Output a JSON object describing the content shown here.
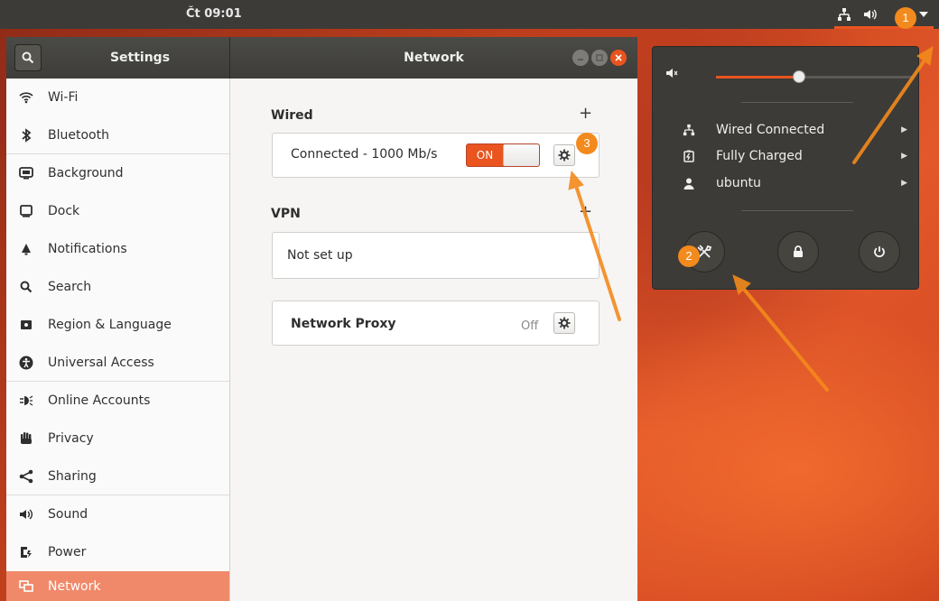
{
  "topbar": {
    "clock": "Čt 09:01",
    "tray_icons": [
      "network-icon",
      "volume-icon",
      "menu-arrow-icon"
    ]
  },
  "window": {
    "sidebar_title": "Settings",
    "page_title": "Network"
  },
  "sidebar": {
    "items": [
      {
        "label": "Wi-Fi",
        "icon": "wifi-icon"
      },
      {
        "label": "Bluetooth",
        "icon": "bluetooth-icon"
      },
      {
        "label": "Background",
        "icon": "background-icon"
      },
      {
        "label": "Dock",
        "icon": "dock-icon"
      },
      {
        "label": "Notifications",
        "icon": "bell-icon"
      },
      {
        "label": "Search",
        "icon": "search-icon"
      },
      {
        "label": "Region & Language",
        "icon": "flag-icon"
      },
      {
        "label": "Universal Access",
        "icon": "accessibility-icon"
      },
      {
        "label": "Online Accounts",
        "icon": "accounts-icon"
      },
      {
        "label": "Privacy",
        "icon": "hand-icon"
      },
      {
        "label": "Sharing",
        "icon": "share-icon"
      },
      {
        "label": "Sound",
        "icon": "speaker-icon"
      },
      {
        "label": "Power",
        "icon": "power-plug-icon"
      },
      {
        "label": "Network",
        "icon": "network-icon"
      }
    ],
    "active": "Network"
  },
  "network": {
    "wired": {
      "title": "Wired",
      "status": "Connected - 1000 Mb/s",
      "toggle_label": "ON"
    },
    "vpn": {
      "title": "VPN",
      "status": "Not set up"
    },
    "proxy": {
      "label": "Network Proxy",
      "state": "Off"
    }
  },
  "system_menu": {
    "volume_percent": 42,
    "items": [
      {
        "label": "Wired Connected",
        "icon": "network-icon"
      },
      {
        "label": "Fully Charged",
        "icon": "battery-icon"
      },
      {
        "label": "ubuntu",
        "icon": "user-icon"
      }
    ],
    "buttons": [
      "settings-icon",
      "lock-icon",
      "power-icon"
    ]
  },
  "annotations": {
    "badges": [
      "1",
      "2",
      "3"
    ],
    "color": "#f38a1d"
  },
  "colors": {
    "accent": "#e9541f",
    "panel": "#3c3b37",
    "sidebar_active": "#f0896a"
  }
}
